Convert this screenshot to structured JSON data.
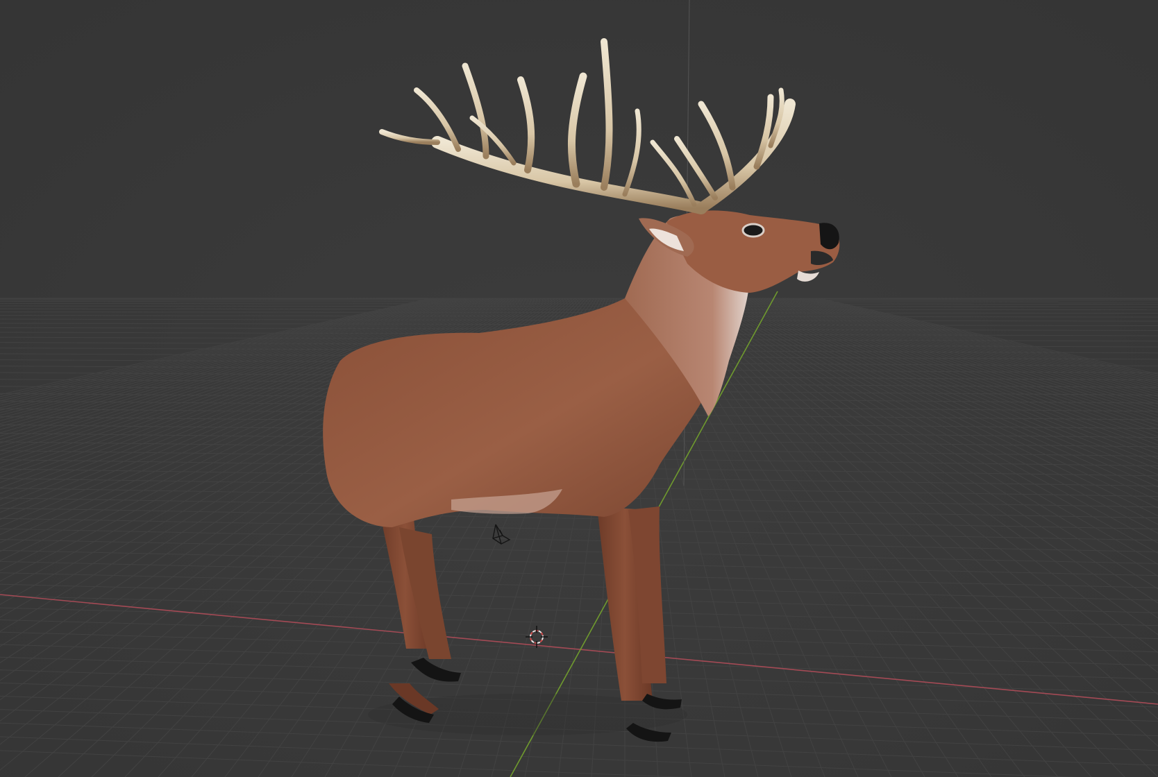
{
  "viewport": {
    "background_color": "#3a3a3a",
    "grid_line_color": "#444444",
    "x_axis_color": "#a44a55",
    "y_axis_color": "#6f9a2e",
    "objects": [
      {
        "name": "deer-model",
        "kind": "mesh"
      },
      {
        "name": "camera-gizmo",
        "kind": "camera"
      },
      {
        "name": "3d-cursor",
        "kind": "cursor"
      }
    ]
  }
}
